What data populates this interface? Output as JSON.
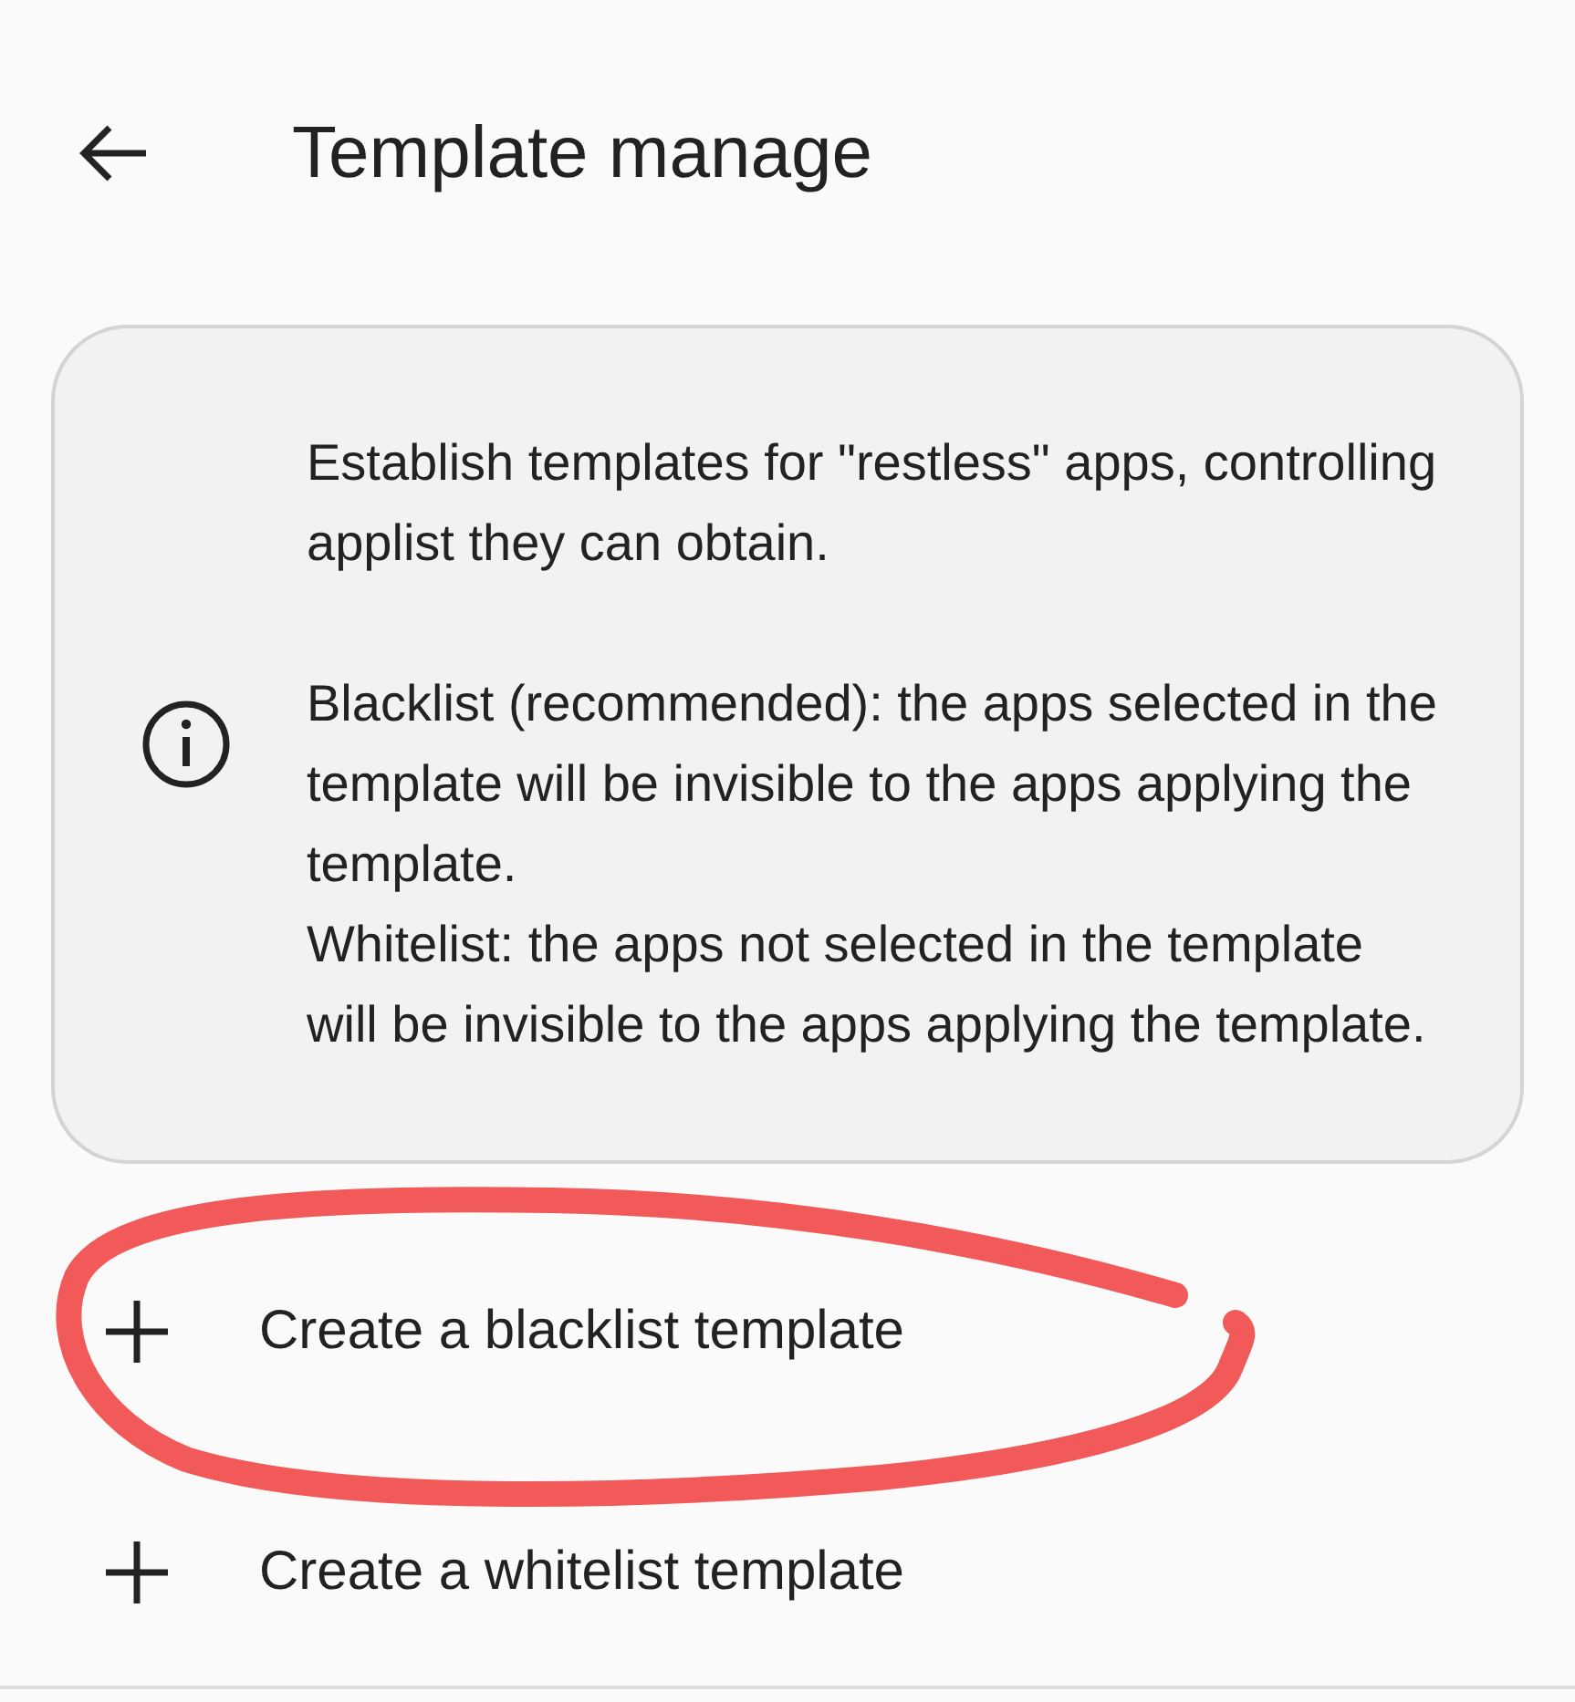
{
  "app_bar": {
    "title": "Template manage"
  },
  "info_card": {
    "paragraphs": [
      "Establish templates for \"restless\" apps, controlling applist they can obtain.",
      "Blacklist (recommended): the apps selected in the template will be invisible to the apps applying the template.\nWhitelist: the apps not selected in the template will be invisible to the apps applying the template."
    ]
  },
  "actions": [
    {
      "label": "Create a blacklist template",
      "highlighted": true
    },
    {
      "label": "Create a whitelist template",
      "highlighted": false
    }
  ]
}
